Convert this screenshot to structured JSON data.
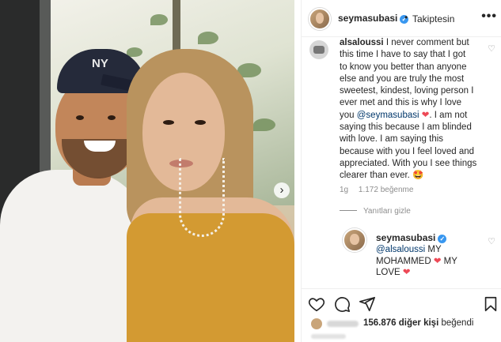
{
  "header": {
    "username": "seymasubasi",
    "verified_mark": "✓",
    "separator": "•",
    "follow_status": "Takiptesin",
    "more_icon": "more-horizontal-icon"
  },
  "photo": {
    "cap_logo": "NY",
    "carousel_next": "›"
  },
  "comment": {
    "username": "alsaloussi",
    "lines": [
      "I never comment but",
      "this time I have to say that I got",
      "to know you better than anyone",
      "else and you are truly the most",
      "sweetest, kindest, loving person I",
      "ever met and this is why I love",
      "you"
    ],
    "mention": "@seymasubasi",
    "heart": "❤",
    "after_mention": ". I am not",
    "lines2": [
      "saying this because I am blinded",
      "with love. I am saying this",
      "because with you I feel loved and",
      "appreciated. With you I see things",
      "clearer than ever."
    ],
    "emoji": "🤩",
    "time": "1g",
    "likes": "1.172 beğenme",
    "replies_toggle": "Yanıtları gizle"
  },
  "reply": {
    "username": "seymasubasi",
    "verified_mark": "✓",
    "mention": "@alsaloussi",
    "text_1": " MY",
    "text_2": "MOHAMMED",
    "text_3": " MY",
    "text_4": "LOVE",
    "heart": "❤"
  },
  "likes_bar": {
    "count": "156.876",
    "text_prefix": " diğer kişi",
    "text_suffix": " beğendi"
  },
  "colors": {
    "link": "#00376b",
    "heart": "#ed4956",
    "verified": "#3897f0",
    "muted": "#8e8e8e"
  }
}
